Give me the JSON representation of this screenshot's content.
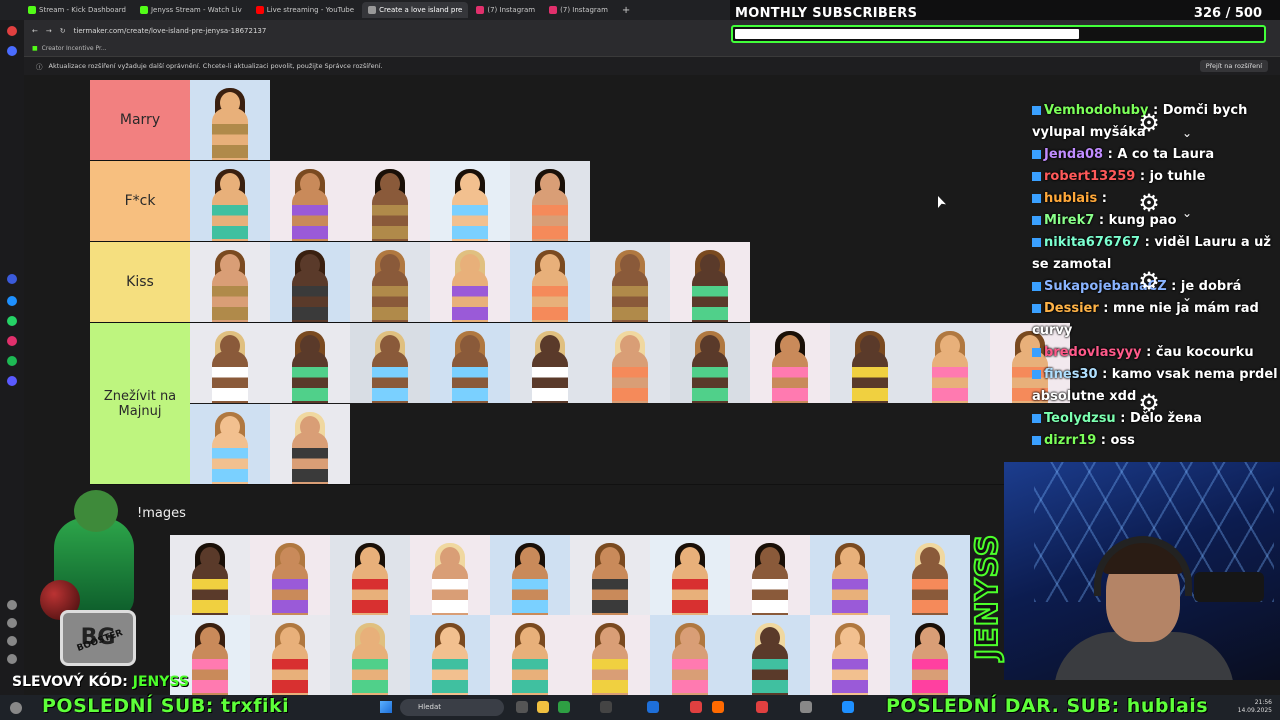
{
  "browser": {
    "tabs": [
      {
        "label": "Stream - Kick Dashboard",
        "color": "#53fc18"
      },
      {
        "label": "Jenyss Stream - Watch Liv",
        "color": "#53fc18"
      },
      {
        "label": "Live streaming - YouTube",
        "color": "#ff0000"
      },
      {
        "label": "Create a love island pre",
        "color": "#999999",
        "active": true
      },
      {
        "label": "(7) Instagram",
        "color": "#e1306c"
      },
      {
        "label": "(7) Instagram",
        "color": "#e1306c"
      }
    ],
    "new_tab": "+",
    "url": "tiermaker.com/create/love-island-pre-jenysa-18672137",
    "bookmark": "Creator Incentive Pr...",
    "infobar_text": "Aktualizace rozšíření vyžaduje další oprávnění. Chcete-li aktualizaci povolit, použijte Správce rozšíření.",
    "infobar_button": "Přejít na rozšíření"
  },
  "subs": {
    "title": "MONTHLY SUBSCRIBERS",
    "count": "326 / 500",
    "progress": 0.652,
    "bar_color": "#42ff3a"
  },
  "tiers": [
    {
      "label": "Marry",
      "color": "#f28080",
      "count": 1
    },
    {
      "label": "F*ck",
      "color": "#f7bf7f",
      "count": 5
    },
    {
      "label": "Kiss",
      "color": "#f5df7f",
      "count": 7
    },
    {
      "label": "Znežívit na Majnuj",
      "color": "#bef57f",
      "count": 13
    }
  ],
  "images_title": "!mages",
  "chat": [
    {
      "user": "Vemhodohuby",
      "color": "#7cff5a",
      "text": ": Domči bych vylupal myšáka"
    },
    {
      "user": "Jenda08",
      "color": "#c08cff",
      "text": ": A co ta Laura"
    },
    {
      "user": "robert13259",
      "color": "#ff5a5a",
      "text": ": jo tuhle"
    },
    {
      "user": "hublais",
      "color": "#ffa83a",
      "text": ":"
    },
    {
      "user": "Mirek7",
      "color": "#8aff8a",
      "text": ": kung pao"
    },
    {
      "user": "nikita676767",
      "color": "#7cffd0",
      "text": ": viděl Lauru a už se zamotal"
    },
    {
      "user": "SukapojebanaCZ",
      "color": "#8ab4ff",
      "text": ": je dobrá"
    },
    {
      "user": "Dessier",
      "color": "#ffb347",
      "text": ": mne nie ja mám rad curvy"
    },
    {
      "user": "bredovlasyyy",
      "color": "#ff5a8a",
      "text": ": čau kocourku"
    },
    {
      "user": "fines30",
      "color": "#b0e0ff",
      "text": ": kamo vsak nema prdel absolutne xdd"
    },
    {
      "user": "Teolydzsu",
      "color": "#7cffb0",
      "text": ": Dělo žena"
    },
    {
      "user": "dizrr19",
      "color": "#7cff5a",
      "text": ": oss"
    }
  ],
  "logo_text": "JENYSS",
  "mascot_badge": "BG",
  "mascot_booster": "BOOSTER",
  "slevovy": {
    "prefix": "SLEVOVÝ KÓD: ",
    "code": "JENYSS"
  },
  "ticker_left": "POSLEDNÍ SUB: trxfiki",
  "ticker_right": "POSLEDNÍ DAR. SUB: hublais",
  "taskbar": {
    "search_placeholder": "Hledat",
    "time": "21:56",
    "date": "14.09.2025"
  }
}
